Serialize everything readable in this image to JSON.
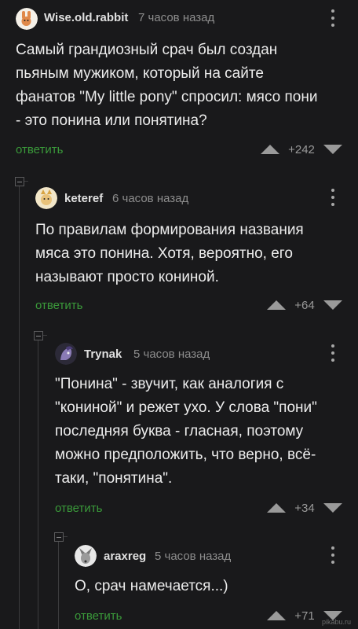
{
  "comments": [
    {
      "author": "Wise.old.rabbit",
      "time": "7 часов назад",
      "text_lines": [
        "Самый грандиозный срач был создан",
        "пьяным мужиком, который на сайте",
        "фанатов \"My little pony\" спросил: мясо пони",
        "- это понина или понятина?"
      ],
      "reply_label": "ответить",
      "rating": "+242",
      "avatar_icon": "rabbit-avatar-icon"
    },
    {
      "author": "keteref",
      "time": "6 часов назад",
      "text_lines": [
        "По правилам формирования названия",
        "мяса это понина. Хотя, вероятно, его",
        "называют просто кониной."
      ],
      "reply_label": "ответить",
      "rating": "+64",
      "avatar_icon": "cat-avatar-icon"
    },
    {
      "author": "Trynak",
      "time": "5 часов назад",
      "text_lines": [
        "\"Понина\" - звучит, как аналогия с",
        "\"кониной\" и режет ухо. У слова \"пони\"",
        "последняя буква - гласная, поэтому",
        "можно предположить, что верно, всё-",
        "таки, \"понятина\"."
      ],
      "reply_label": "ответить",
      "rating": "+34",
      "avatar_icon": "pony-avatar-icon"
    },
    {
      "author": "araxreg",
      "time": "5 часов назад",
      "text_lines": [
        "О, срач намечается...)"
      ],
      "reply_label": "ответить",
      "rating": "+71",
      "avatar_icon": "dog-avatar-icon"
    }
  ],
  "watermark": "pikabu.ru",
  "colors": {
    "background": "#19191b",
    "reply": "#3a9a3a",
    "text": "#ececec",
    "muted": "#8d8d8d",
    "thread_line": "#3b3b3d"
  }
}
